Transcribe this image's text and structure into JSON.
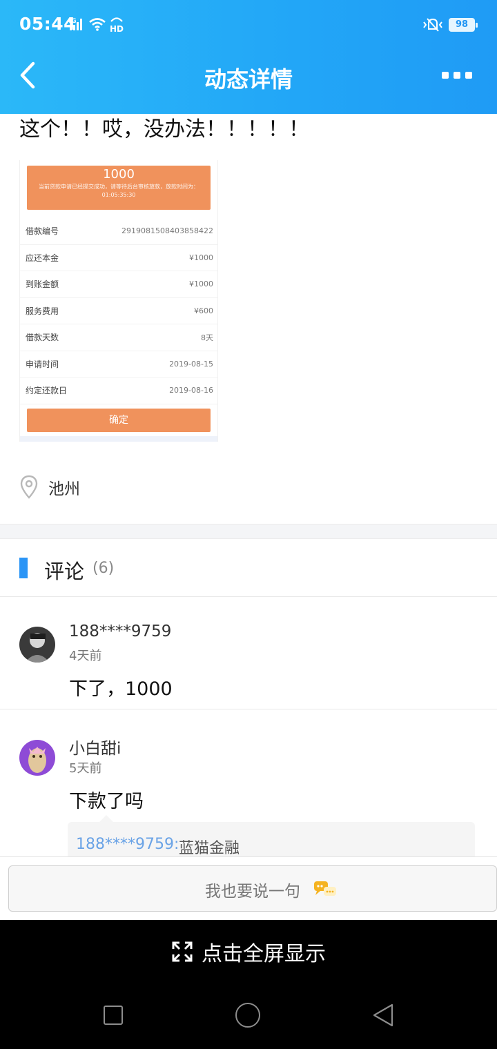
{
  "status_bar": {
    "time": "05:44",
    "network": "4G",
    "hd": "HD",
    "battery": "98"
  },
  "header": {
    "title": "动态详情"
  },
  "post": {
    "text": "这个！！哎，没办法！！！！！",
    "receipt": {
      "amount": "1000",
      "notice": "当前贷款申请已经提交成功，请等待后台审核放款，放款时间为：01:05:35:30",
      "rows": [
        {
          "label": "借款编号",
          "value": "2919081508403858422"
        },
        {
          "label": "应还本金",
          "value": "¥1000"
        },
        {
          "label": "到账金额",
          "value": "¥1000"
        },
        {
          "label": "服务费用",
          "value": "¥600"
        },
        {
          "label": "借款天数",
          "value": "8天"
        },
        {
          "label": "申请时间",
          "value": "2019-08-15"
        },
        {
          "label": "约定还款日",
          "value": "2019-08-16"
        }
      ],
      "confirm_label": "确定"
    },
    "location": "池州"
  },
  "comments_section": {
    "title": "评论",
    "count": "(6)",
    "comments": [
      {
        "user": "188****9759",
        "time": "4天前",
        "text": "下了，1000"
      },
      {
        "user": "小白甜i",
        "time": "5天前",
        "text": "下款了吗",
        "reply": {
          "user": "188****9759:",
          "text": "蓝猫金融"
        }
      }
    ]
  },
  "input": {
    "placeholder": "我也要说一句"
  },
  "fullscreen": {
    "label": "点击全屏显示"
  },
  "colors": {
    "header_blue": "#22a6f7",
    "accent_blue": "#2b95f6",
    "orange": "#f0925c",
    "link_blue": "#6aa3e6"
  }
}
